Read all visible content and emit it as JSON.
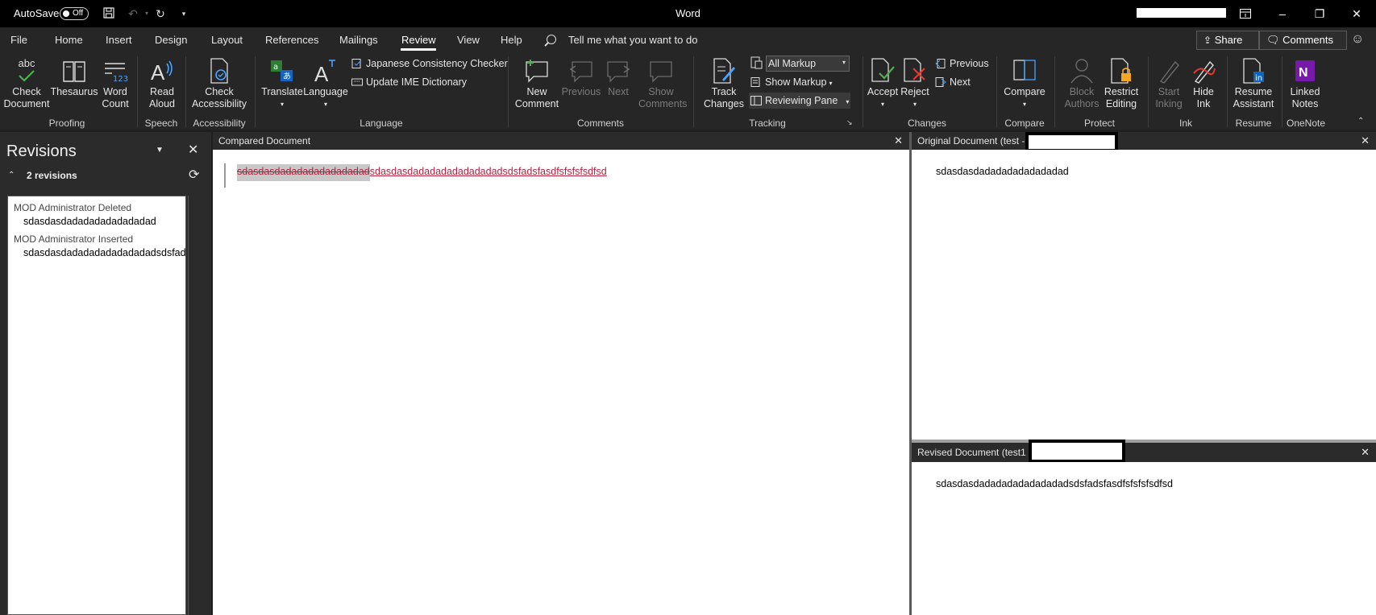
{
  "titlebar": {
    "autosave_label": "AutoSave",
    "autosave_state": "Off",
    "app_title": "Word"
  },
  "tabs": [
    "File",
    "Home",
    "Insert",
    "Design",
    "Layout",
    "References",
    "Mailings",
    "Review",
    "View",
    "Help"
  ],
  "active_tab": "Review",
  "tell_me": "Tell me what you want to do",
  "share_label": "Share",
  "comments_label": "Comments",
  "ribbon": {
    "proofing": {
      "group": "Proofing",
      "check_doc": [
        "Check",
        "Document"
      ],
      "thesaurus": "Thesaurus",
      "word_count": [
        "Word",
        "Count"
      ]
    },
    "speech": {
      "group": "Speech",
      "read_aloud": [
        "Read",
        "Aloud"
      ]
    },
    "accessibility": {
      "group": "Accessibility",
      "check_acc": [
        "Check",
        "Accessibility"
      ]
    },
    "language": {
      "group": "Language",
      "translate": "Translate",
      "language": "Language",
      "japanese": "Japanese Consistency Checker",
      "ime": "Update IME Dictionary"
    },
    "comments": {
      "group": "Comments",
      "new": [
        "New",
        "Comment"
      ],
      "previous": "Previous",
      "next": "Next",
      "show": [
        "Show",
        "Comments"
      ]
    },
    "tracking": {
      "group": "Tracking",
      "track": [
        "Track",
        "Changes"
      ],
      "markup_select": "All Markup",
      "show_markup": "Show Markup",
      "reviewing_pane": "Reviewing Pane"
    },
    "changes": {
      "group": "Changes",
      "accept": "Accept",
      "reject": "Reject",
      "previous": "Previous",
      "next": "Next"
    },
    "compare": {
      "group": "Compare",
      "compare": "Compare"
    },
    "protect": {
      "group": "Protect",
      "block": [
        "Block",
        "Authors"
      ],
      "restrict": [
        "Restrict",
        "Editing"
      ]
    },
    "ink": {
      "group": "Ink",
      "start": [
        "Start",
        "Inking"
      ],
      "hide": [
        "Hide",
        "Ink"
      ]
    },
    "resume": {
      "group": "Resume",
      "assistant": [
        "Resume",
        "Assistant"
      ]
    },
    "onenote": {
      "group": "OneNote",
      "linked": [
        "Linked",
        "Notes"
      ]
    }
  },
  "revisions": {
    "title": "Revisions",
    "count": "2 revisions",
    "items": [
      {
        "author": "MOD Administrator Deleted",
        "text": "sdasdasdadadadadadadadad"
      },
      {
        "author": "MOD Administrator Inserted",
        "text": "sdasdasdadadadadadadadadsdsfadsfasdfsfsfsfsdfsd"
      }
    ]
  },
  "compared": {
    "title": "Compared Document",
    "deleted": "sdasdasdadadadadadadadad",
    "inserted": "sdasdasdadadadadadadadadsdsfadsfasdfsfsfsfsdfsd"
  },
  "original": {
    "title": "Original Document (test -",
    "text": "sdasdasdadadadadadadadad"
  },
  "revised": {
    "title": "Revised Document (test1 -",
    "text": "sdasdasdadadadadadadadadsdsfadsfasdfsfsfsfsdfsd"
  },
  "colors": {
    "deleted": "#b0223d",
    "inserted": "#b0223d",
    "ribbon": "#262626",
    "titlebar": "#000000"
  }
}
